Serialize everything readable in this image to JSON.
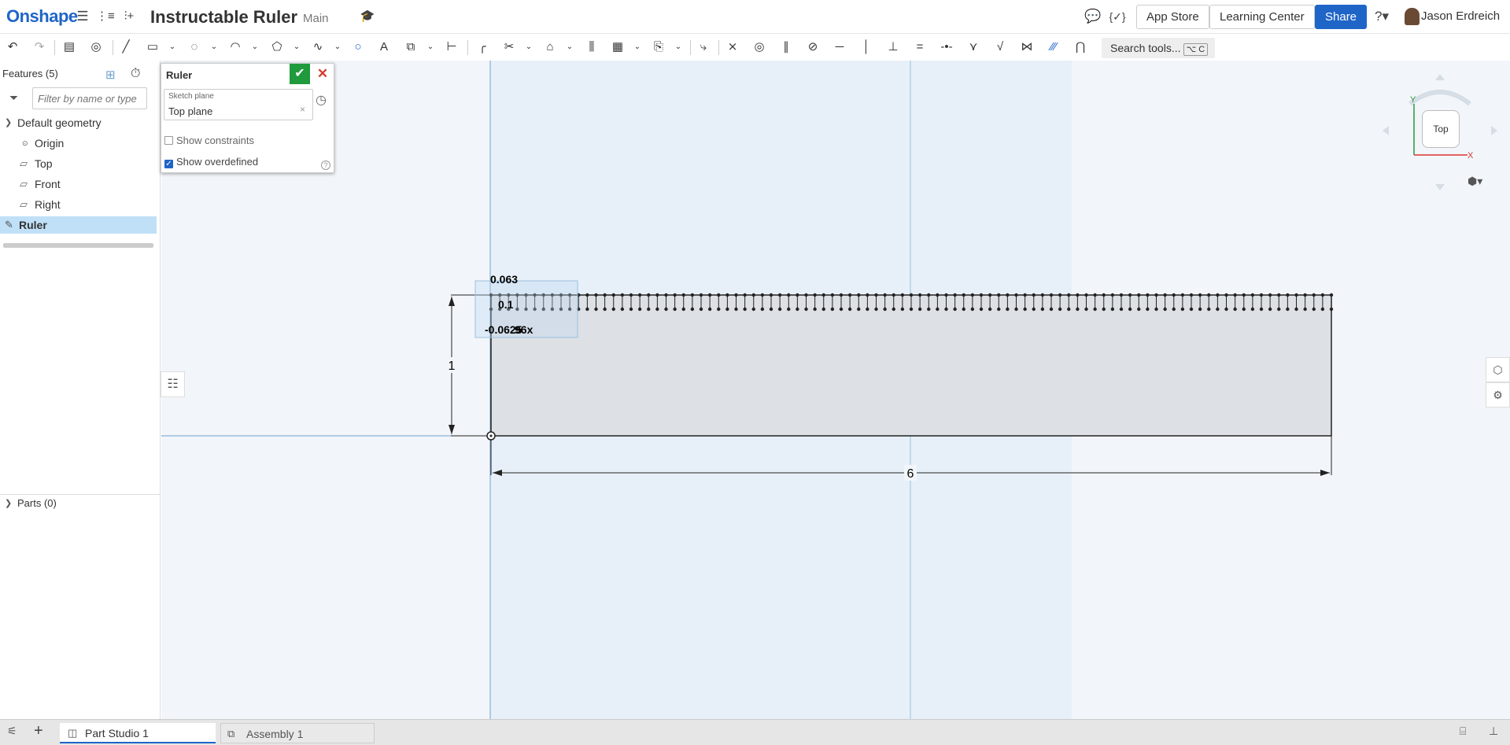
{
  "header": {
    "logo": "Onshape",
    "title": "Instructable Ruler",
    "branch": "Main",
    "app_store": "App Store",
    "learning_center": "Learning Center",
    "share": "Share",
    "user": "Jason Erdreich"
  },
  "toolbar": {
    "search_tools": "Search tools...",
    "search_shortcut": "⌥ C"
  },
  "features": {
    "title": "Features (5)",
    "filter_placeholder": "Filter by name or type",
    "items": [
      {
        "label": "Default geometry"
      },
      {
        "label": "Origin"
      },
      {
        "label": "Top"
      },
      {
        "label": "Front"
      },
      {
        "label": "Right"
      },
      {
        "label": "Ruler"
      }
    ],
    "parts": "Parts (0)"
  },
  "dialog": {
    "title": "Ruler",
    "sketch_plane_label": "Sketch plane",
    "sketch_plane_value": "Top plane",
    "show_constraints": "Show constraints",
    "show_constraints_checked": false,
    "show_overdefined": "Show overdefined",
    "show_overdefined_checked": true
  },
  "sketch": {
    "dim_height": "1",
    "dim_width": "6",
    "dim_tick_top": "0.063",
    "dim_tick_len": "0.1",
    "dim_pattern": "-0.0625",
    "pattern_count": "96x"
  },
  "viewcube": {
    "face": "Top",
    "axis_y": "Y",
    "axis_x": "X"
  },
  "tabs": {
    "part_studio": "Part Studio 1",
    "assembly": "Assembly 1"
  },
  "colors": {
    "brand": "#1f65c8",
    "accept": "#1f9a3c",
    "cancel": "#d53b2d",
    "selection": "#bfe0f7"
  }
}
